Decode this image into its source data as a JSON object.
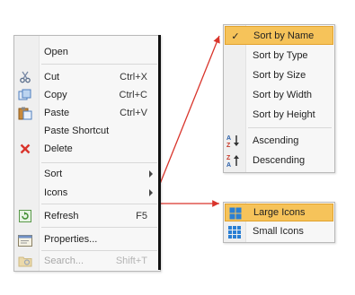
{
  "context_menu": {
    "items": [
      {
        "label": "Open",
        "shortcut": "",
        "icon": "",
        "disabled": false,
        "submenu": false
      },
      {
        "label": "Cut",
        "shortcut": "Ctrl+X",
        "icon": "scissors-icon",
        "disabled": false,
        "submenu": false
      },
      {
        "label": "Copy",
        "shortcut": "Ctrl+C",
        "icon": "copy-icon",
        "disabled": false,
        "submenu": false
      },
      {
        "label": "Paste",
        "shortcut": "Ctrl+V",
        "icon": "paste-icon",
        "disabled": false,
        "submenu": false
      },
      {
        "label": "Paste Shortcut",
        "shortcut": "",
        "icon": "",
        "disabled": false,
        "submenu": false
      },
      {
        "label": "Delete",
        "shortcut": "",
        "icon": "delete-x-icon",
        "disabled": false,
        "submenu": false
      },
      {
        "label": "Sort",
        "shortcut": "",
        "icon": "",
        "disabled": false,
        "submenu": true
      },
      {
        "label": "Icons",
        "shortcut": "",
        "icon": "",
        "disabled": false,
        "submenu": true
      },
      {
        "label": "Refresh",
        "shortcut": "F5",
        "icon": "refresh-icon",
        "disabled": false,
        "submenu": false
      },
      {
        "label": "Properties...",
        "shortcut": "",
        "icon": "properties-icon",
        "disabled": false,
        "submenu": false
      },
      {
        "label": "Search...",
        "shortcut": "Shift+T",
        "icon": "search-folder-icon",
        "disabled": true,
        "submenu": false
      }
    ]
  },
  "sort_menu": {
    "items": [
      {
        "label": "Sort by Name",
        "checked": true,
        "highlighted": true
      },
      {
        "label": "Sort by Type",
        "checked": false,
        "highlighted": false
      },
      {
        "label": "Sort by Size",
        "checked": false,
        "highlighted": false
      },
      {
        "label": "Sort by Width",
        "checked": false,
        "highlighted": false
      },
      {
        "label": "Sort by Height",
        "checked": false,
        "highlighted": false
      }
    ],
    "order_items": [
      {
        "label": "Ascending",
        "icon": "sort-ascending-icon"
      },
      {
        "label": "Descending",
        "icon": "sort-descending-icon"
      }
    ],
    "check_glyph": "✓"
  },
  "icons_menu": {
    "items": [
      {
        "label": "Large Icons",
        "icon": "large-icons-icon",
        "highlighted": true
      },
      {
        "label": "Small Icons",
        "icon": "small-icons-icon",
        "highlighted": false
      }
    ]
  },
  "colors": {
    "highlight": "#f6c35a",
    "arrow": "#d9342b",
    "delete": "#d9342b",
    "grid_icon": "#2a7fd4"
  }
}
